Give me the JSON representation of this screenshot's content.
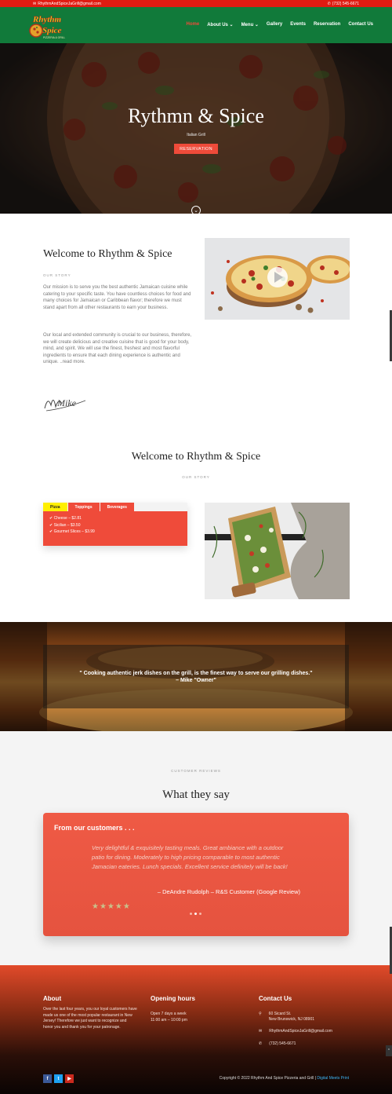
{
  "topbar": {
    "email": "RhythmAndSpiceJaGrill@gmail.com",
    "phone": "(732) 545-6671"
  },
  "header": {
    "logo_text_1": "Rhythm",
    "logo_text_2": "Spice",
    "logo_text_3": "PIZZERIA & GRILL",
    "nav": [
      {
        "label": "Home"
      },
      {
        "label": "About Us ⌄"
      },
      {
        "label": "Menu ⌄"
      },
      {
        "label": "Gallery"
      },
      {
        "label": "Events"
      },
      {
        "label": "Reservation"
      },
      {
        "label": "Contact Us"
      }
    ]
  },
  "hero": {
    "title": "Rythmn & Spice",
    "subtitle": "Italian Grill",
    "button": "RESERVATION",
    "down_arrow": "⌄"
  },
  "welcome1": {
    "title": "Welcome to Rhythm & Spice",
    "kicker": "OUR STORY",
    "para1": "Our mission is to serve you the best authentic Jamaican cuisine while catering to your specific taste. You have countless choices for food and many choices for Jamaican or Caribbean flavor; therefore we must stand apart from all other restaurants to earn your business.",
    "para2": "Our local and extended community is crucial to our business, therefore, we will create delicious and creative cuisine that is good for your body, mind, and spirit. We will use the finest, freshest and most flavorful ingredients to ensure that each dining experience is authentic and unique. ..read more.",
    "signature": "Mike"
  },
  "welcome2": {
    "title": "Welcome to Rhythm & Spice",
    "kicker": "OUR STORY",
    "tabs": [
      "Pizza",
      "Toppings",
      "Beverages"
    ],
    "items": [
      "✔ Cheese – $2.81",
      "✔ Sicilian – $3.50",
      "✔ Gourmet Slices – $3.99"
    ]
  },
  "quote": {
    "line1": "\" Cooking authentic jerk dishes on the grill, is the finest way to serve our grilling dishes.\"",
    "line2": "– Mike \"Owner\""
  },
  "reviews": {
    "kicker": "CUSTOMER REVIEWS",
    "title": "What they say",
    "card_heading": "From our customers . . .",
    "body": "Very delightful & exquisitely tasting meals. Great ambiance with a outdoor patio for dining. Moderately to high pricing comparable to most authentic Jamacian eateries. Lunch specials. Excellent service definitely will be back!",
    "author": "– DeAndre Rudolph – R&S Customer (Google Review)",
    "stars": "★★★★★",
    "rating": 5
  },
  "footer": {
    "about_title": "About",
    "about_text": "Over the last four years, you our loyal customers have made us one of the most popular restaurant in New Jersey! Therefore we just want to recognize and honor you and thank you for your patronage.",
    "hours_title": "Opening hours",
    "hours_line1": "Open 7 days a week",
    "hours_line2": "11:00 am – 10:00 pm",
    "contact_title": "Contact Us",
    "address1": "60 Sicard St.",
    "address2": "New Brunswick, NJ 08901",
    "email": "RhythmAndSpiceJaGrill@gmail.com",
    "phone": "(732) 545-6671",
    "copyright_text": "Copyright © 2022 Rhythm And Spice Pizzeria and Grill | ",
    "copyright_link": "Digital Meets Print",
    "socials": [
      "f",
      "t",
      "▶"
    ]
  },
  "colors": {
    "header_green": "#117a3a",
    "top_red": "#e01b12",
    "accent_red": "#ef4b3a",
    "tab_yellow": "#ffef00"
  }
}
